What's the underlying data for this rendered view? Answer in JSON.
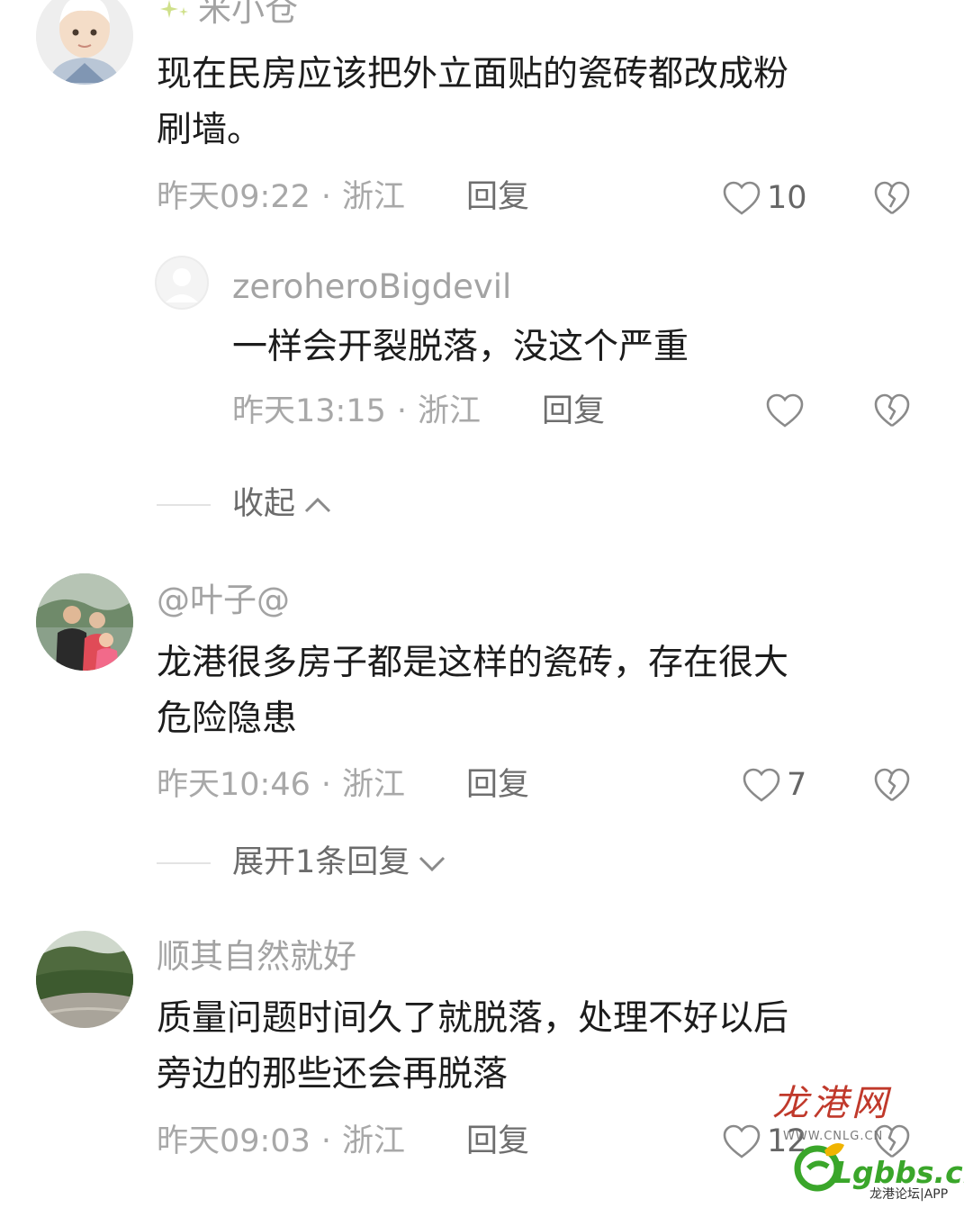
{
  "comments": [
    {
      "username": "米小仓",
      "text_line1": "现在民房应该把外立面贴的瓷砖都改成粉",
      "text_line2": "刷墙。",
      "time": "昨天09:22",
      "location": "浙江",
      "reply_label": "回复",
      "likes": "10"
    },
    {
      "username": "@叶子@",
      "text_line1": "龙港很多房子都是这样的瓷砖，存在很大",
      "text_line2": "危险隐患",
      "time": "昨天10:46",
      "location": "浙江",
      "reply_label": "回复",
      "likes": "7"
    },
    {
      "username": "顺其自然就好",
      "text_line1": "质量问题时间久了就脱落，处理不好以后",
      "text_line2": "旁边的那些还会再脱落",
      "time": "昨天09:03",
      "location": "浙江",
      "reply_label": "回复",
      "likes": "12"
    }
  ],
  "sub_reply": {
    "username": "zeroheroBigdevil",
    "text": "一样会开裂脱落，没这个严重",
    "time": "昨天13:15",
    "location": "浙江",
    "reply_label": "回复"
  },
  "collapse_label": "收起",
  "expand_label": "展开1条回复",
  "separator": "·",
  "watermark": {
    "logo": "龙港网",
    "site": "WWW.CNLG.CN",
    "brand": "Lgbbs.cn",
    "tag": "龙港论坛|APP"
  },
  "colors": {
    "meta_gray": "#a8a8a8",
    "text": "#1c1c1c",
    "watermark_red": "#c0392b",
    "watermark_green": "#3aa62a"
  }
}
